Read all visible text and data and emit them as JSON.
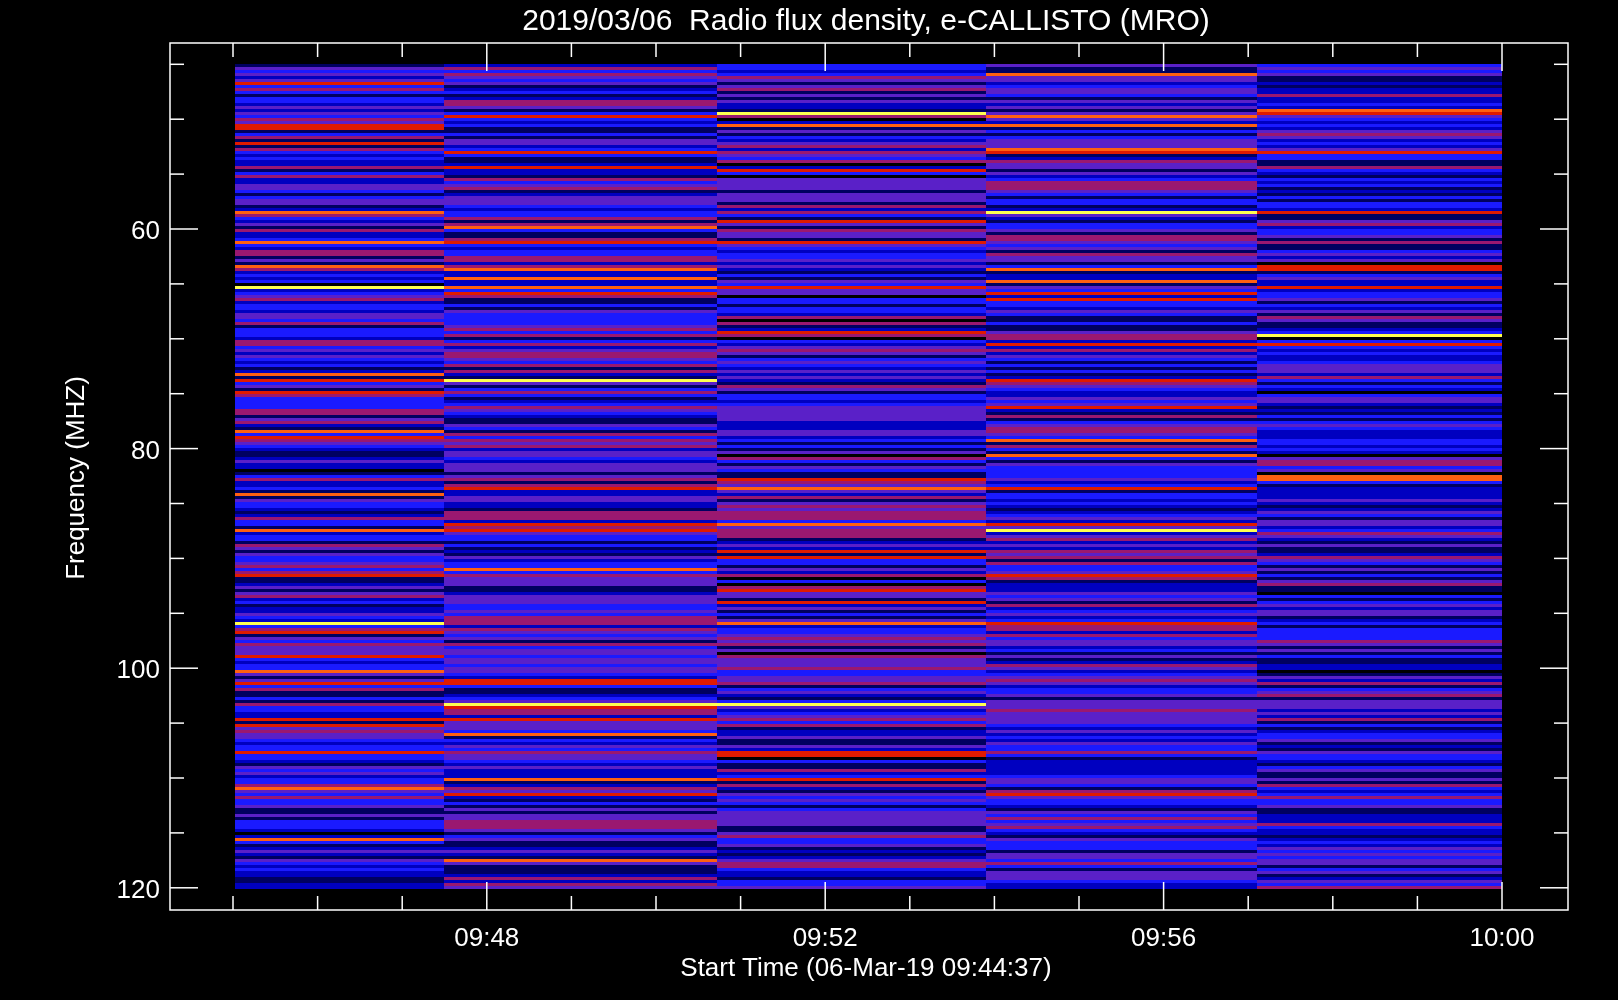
{
  "title": "2019/03/06  Radio flux density, e-CALLISTO (MRO)",
  "y_axis": {
    "label": "Frequency (MHZ)",
    "ticks": [
      "60",
      "80",
      "100",
      "120"
    ]
  },
  "x_axis": {
    "label": "Start Time (06-Mar-19 09:44:37)",
    "ticks": [
      "09:48",
      "09:52",
      "09:56",
      "10:00"
    ]
  }
}
